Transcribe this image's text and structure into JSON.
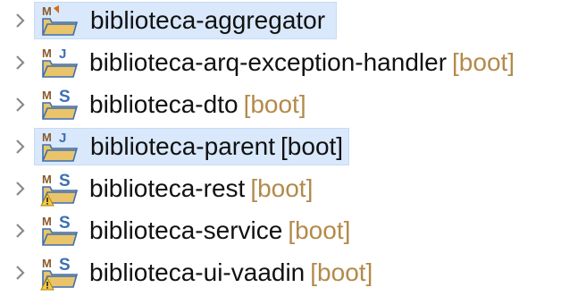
{
  "projects": [
    {
      "name": "biblioteca-aggregator",
      "decoration": "",
      "selected": true,
      "icon": "maven-project-folder-icon",
      "warning": false,
      "decoration_dark": false
    },
    {
      "name": "biblioteca-arq-exception-handler",
      "decoration": "[boot]",
      "selected": false,
      "icon": "maven-java-project-folder-icon",
      "warning": false,
      "decoration_dark": false
    },
    {
      "name": "biblioteca-dto",
      "decoration": "[boot]",
      "selected": false,
      "icon": "maven-spring-project-folder-icon",
      "warning": false,
      "decoration_dark": false
    },
    {
      "name": "biblioteca-parent",
      "decoration": "[boot]",
      "selected": true,
      "icon": "maven-java-project-folder-icon",
      "warning": false,
      "decoration_dark": true
    },
    {
      "name": "biblioteca-rest",
      "decoration": "[boot]",
      "selected": false,
      "icon": "maven-spring-project-folder-warning-icon",
      "warning": true,
      "decoration_dark": false
    },
    {
      "name": "biblioteca-service",
      "decoration": "[boot]",
      "selected": false,
      "icon": "maven-spring-project-folder-icon",
      "warning": false,
      "decoration_dark": false
    },
    {
      "name": "biblioteca-ui-vaadin",
      "decoration": "[boot]",
      "selected": false,
      "icon": "maven-spring-project-folder-warning-icon",
      "warning": true,
      "decoration_dark": false
    }
  ],
  "colors": {
    "selection": "#d9e8fb",
    "decoration": "#b38a4a",
    "folder": "#e9c46a",
    "spring": "#4a8fd4",
    "maven": "#8a5a2b"
  }
}
